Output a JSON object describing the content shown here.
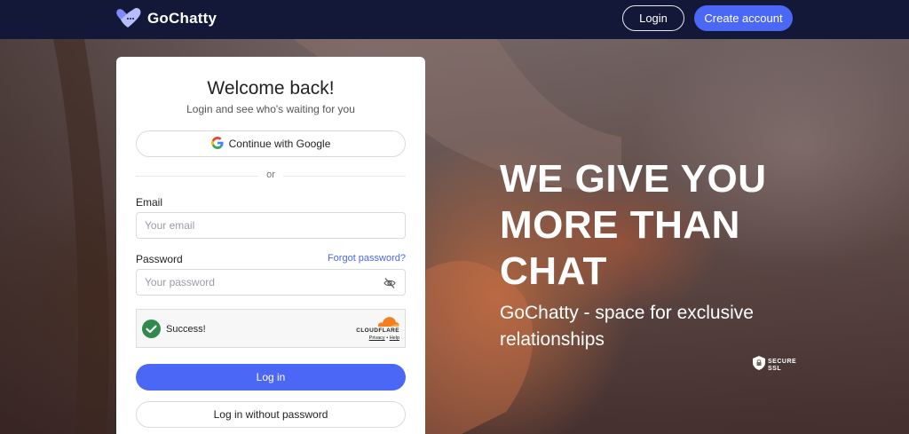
{
  "header": {
    "brand": "GoChatty",
    "login_label": "Login",
    "create_account_label": "Create account"
  },
  "login_card": {
    "title": "Welcome back!",
    "subtitle": "Login and see who's waiting for you",
    "google_button_label": "Continue with Google",
    "divider_text": "or",
    "email_label": "Email",
    "email_placeholder": "Your email",
    "email_value": "",
    "password_label": "Password",
    "forgot_password_label": "Forgot password?",
    "password_placeholder": "Your password",
    "password_value": "",
    "captcha": {
      "status_text": "Success!",
      "brand": "CLOUDFLARE",
      "privacy_label": "Privacy",
      "separator": "•",
      "help_label": "Help"
    },
    "login_button_label": "Log in",
    "passwordless_button_label": "Log in without password"
  },
  "hero": {
    "headline": "WE GIVE YOU MORE THAN CHAT",
    "tagline": "GoChatty - space for exclusive relationships",
    "badge_line1": "SECURE",
    "badge_line2": "SSL"
  },
  "colors": {
    "navbar": "#131838",
    "accent": "#4a67f5",
    "success": "#2f8a4c",
    "cloudflare_orange": "#f38020"
  },
  "icons": [
    "heart-logo-icon",
    "google-icon",
    "eye-slash-icon",
    "check-icon",
    "cloudflare-cloud-icon",
    "shield-lock-icon"
  ]
}
